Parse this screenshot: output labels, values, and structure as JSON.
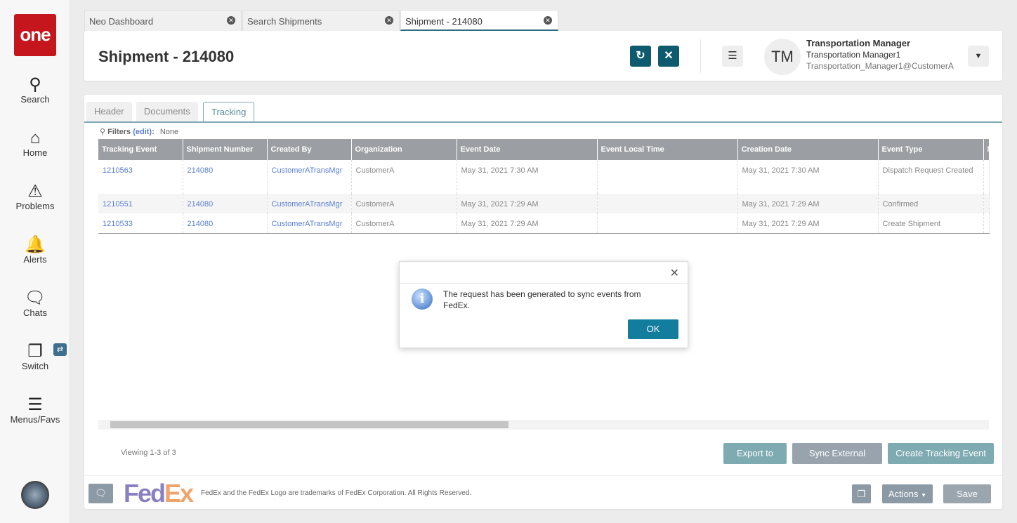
{
  "sidebar": {
    "logo": "one",
    "items": [
      {
        "label": "Search"
      },
      {
        "label": "Home"
      },
      {
        "label": "Problems"
      },
      {
        "label": "Alerts"
      },
      {
        "label": "Chats"
      },
      {
        "label": "Switch"
      },
      {
        "label": "Menus/Favs"
      }
    ]
  },
  "tabs": [
    {
      "label": "Neo Dashboard"
    },
    {
      "label": "Search Shipments"
    },
    {
      "label": "Shipment - 214080"
    }
  ],
  "header": {
    "title": "Shipment - 214080",
    "user": {
      "initials": "TM",
      "role": "Transportation Manager",
      "name": "Transportation Manager1",
      "email": "Transportation_Manager1@CustomerA"
    }
  },
  "content_tabs": [
    {
      "label": "Header"
    },
    {
      "label": "Documents"
    },
    {
      "label": "Tracking"
    }
  ],
  "filters": {
    "label": "Filters",
    "edit": "(edit)",
    "colon": ":",
    "value": "None"
  },
  "table": {
    "columns": [
      "Tracking Event",
      "Shipment Number",
      "Created By",
      "Organization",
      "Event Date",
      "Event Local Time",
      "Creation Date",
      "Event Type",
      "N"
    ],
    "rows": [
      [
        "1210563",
        "214080",
        "CustomerATransMgr",
        "CustomerA",
        "May 31, 2021 7:30 AM",
        "",
        "May 31, 2021 7:30 AM",
        "Dispatch Request Created"
      ],
      [
        "1210551",
        "214080",
        "CustomerATransMgr",
        "CustomerA",
        "May 31, 2021 7:29 AM",
        "",
        "May 31, 2021 7:29 AM",
        "Confirmed"
      ],
      [
        "1210533",
        "214080",
        "CustomerATransMgr",
        "CustomerA",
        "May 31, 2021 7:29 AM",
        "",
        "May 31, 2021 7:29 AM",
        "Create Shipment"
      ]
    ]
  },
  "viewing": "Viewing 1-3 of 3",
  "buttons": {
    "export": "Export to CSV",
    "sync": "Sync External Events",
    "create": "Create Tracking Event",
    "actions": "Actions",
    "save": "Save"
  },
  "footer": {
    "logo": "FedEx",
    "trademark": "FedEx and the FedEx Logo are trademarks of FedEx Corporation. All Rights Reserved."
  },
  "dialog": {
    "message": "The request has been generated to sync events from FedEx.",
    "ok": "OK"
  }
}
